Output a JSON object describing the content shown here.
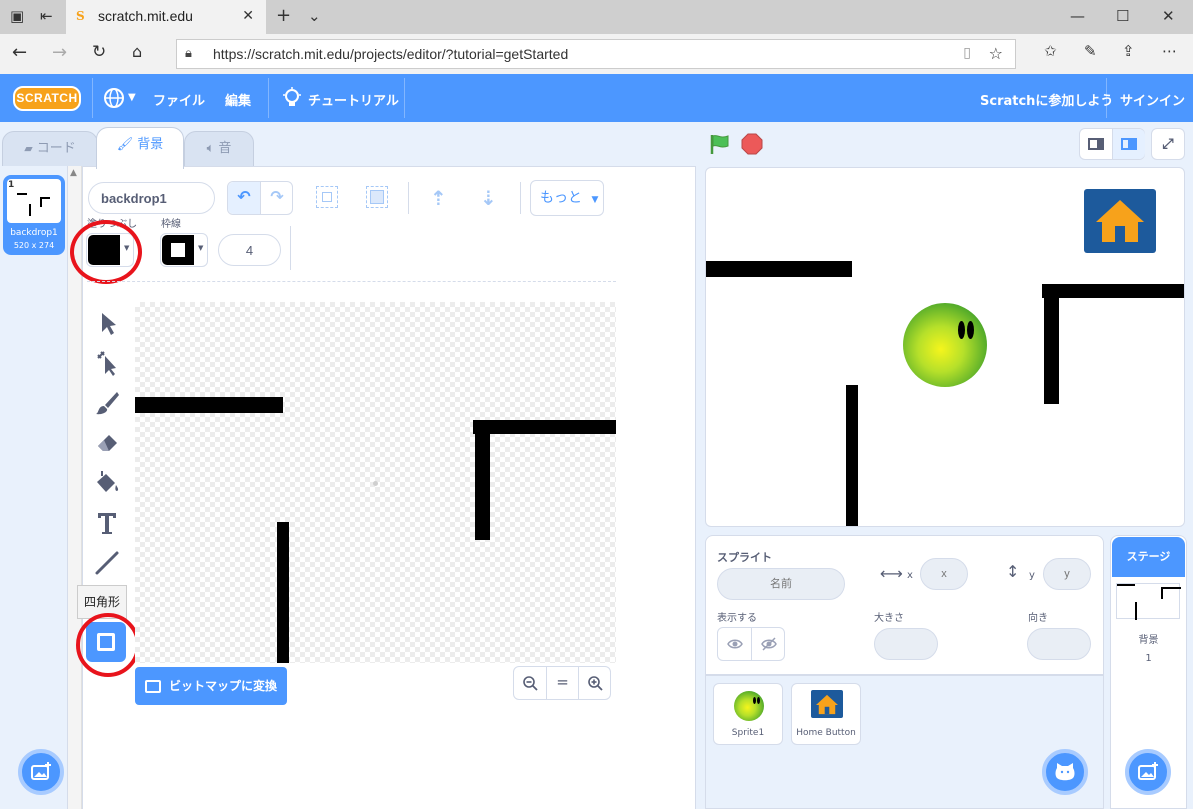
{
  "browser": {
    "tab_title": "scratch.mit.edu",
    "tab_favicon": "S",
    "url": "https://scratch.mit.edu/projects/editor/?tutorial=getStarted"
  },
  "menubar": {
    "logo": "SCRATCH",
    "file": "ファイル",
    "edit": "編集",
    "tutorials": "チュートリアル",
    "join": "Scratchに参加しよう",
    "signin": "サインイン"
  },
  "tabs": {
    "code": "コード",
    "backdrops": "背景",
    "sounds": "音"
  },
  "costume": {
    "number": "1",
    "name": "backdrop1",
    "size": "520 x 274"
  },
  "paint": {
    "costume_name": "backdrop1",
    "more_label": "もっと",
    "fill_label": "塗りつぶし",
    "outline_label": "枠線",
    "outline_width": "4",
    "tooltip": "四角形",
    "convert_bitmap": "ビットマップに変換",
    "zoom_reset": "="
  },
  "sprite_info": {
    "sprite_label": "スプライト",
    "name_placeholder": "名前",
    "x_label": "x",
    "y_label": "y",
    "x_placeholder": "x",
    "y_placeholder": "y",
    "show_label": "表示する",
    "size_label": "大きさ",
    "direction_label": "向き"
  },
  "sprites": [
    {
      "name": "Sprite1"
    },
    {
      "name": "Home Button"
    }
  ],
  "stage_pane": {
    "title": "ステージ",
    "backdrops_label": "背景",
    "backdrops_count": "1"
  },
  "colors": {
    "scratch_blue": "#4c97ff",
    "highlight_red": "#e8141c",
    "scratch_orange": "#f7a21b",
    "green_flag": "#4cbf56",
    "stop": "#ec5959"
  }
}
